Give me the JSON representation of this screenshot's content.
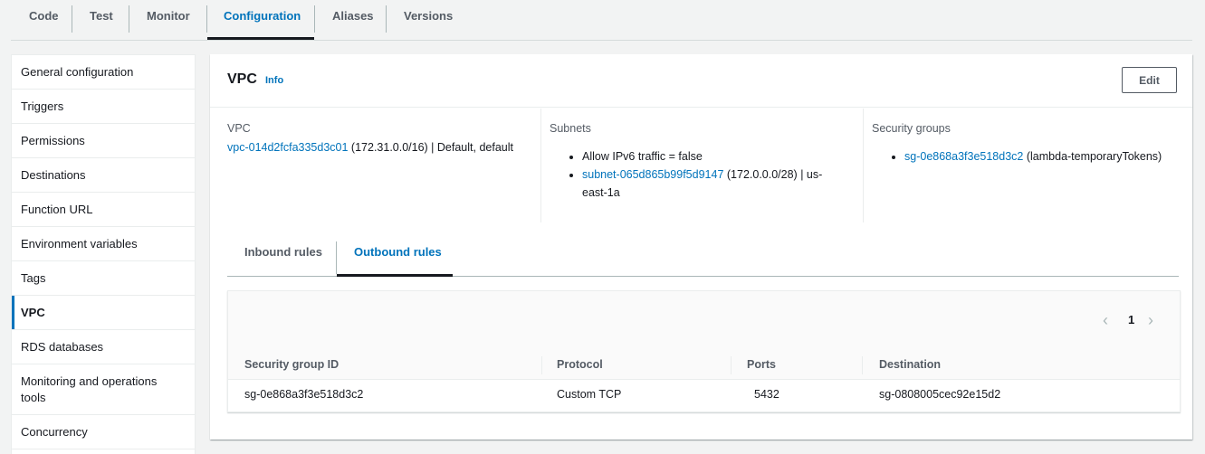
{
  "top_tabs": [
    "Code",
    "Test",
    "Monitor",
    "Configuration",
    "Aliases",
    "Versions"
  ],
  "top_tabs_active": "Configuration",
  "sidebar": {
    "items": [
      "General configuration",
      "Triggers",
      "Permissions",
      "Destinations",
      "Function URL",
      "Environment variables",
      "Tags",
      "VPC",
      "RDS databases",
      "Monitoring and operations tools",
      "Concurrency"
    ],
    "active": "VPC"
  },
  "panel": {
    "title": "VPC",
    "info": "Info",
    "edit_label": "Edit"
  },
  "vpc": {
    "label": "VPC",
    "id_link": "vpc-014d2fcfa335d3c01",
    "details": "(172.31.0.0/16) | Default, default"
  },
  "subnets": {
    "label": "Subnets",
    "ipv6": "Allow IPv6 traffic = false",
    "subnet_link": "subnet-065d865b99f5d9147",
    "subnet_details": "(172.0.0.0/28) | us-east-1a"
  },
  "security_groups": {
    "label": "Security groups",
    "sg_link": "sg-0e868a3f3e518d3c2",
    "sg_name": "(lambda-temporaryTokens)"
  },
  "rule_tabs": {
    "inbound": "Inbound rules",
    "outbound": "Outbound rules",
    "active": "Outbound rules"
  },
  "table": {
    "page": "1",
    "prev_icon": "chevron-left-icon",
    "next_icon": "chevron-right-icon",
    "columns": [
      "Security group ID",
      "Protocol",
      "Ports",
      "Destination"
    ],
    "rows": [
      [
        "sg-0e868a3f3e518d3c2",
        "Custom TCP",
        "5432",
        "sg-0808005cec92e15d2"
      ]
    ]
  },
  "colors": {
    "accent": "#0073bb",
    "text": "#16191f",
    "muted": "#545b64",
    "background": "#f2f3f3"
  }
}
